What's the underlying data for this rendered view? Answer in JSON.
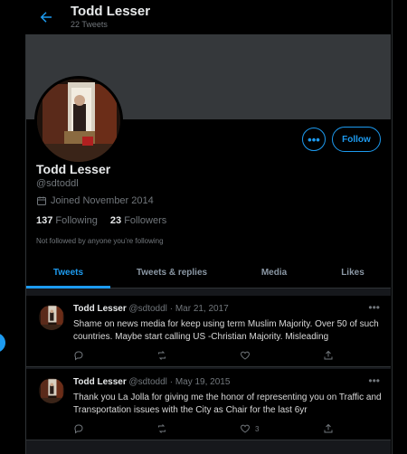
{
  "header": {
    "name": "Todd Lesser",
    "tweet_count": "22 Tweets"
  },
  "profile": {
    "name": "Todd Lesser",
    "handle": "@sdtoddl",
    "joined": "Joined November 2014",
    "following_count": "137",
    "following_label": "Following",
    "followers_count": "23",
    "followers_label": "Followers",
    "followed_note": "Not followed by anyone you’re following",
    "more_label": "•••",
    "follow_label": "Follow"
  },
  "tabs": [
    {
      "label": "Tweets"
    },
    {
      "label": "Tweets & replies"
    },
    {
      "label": "Media"
    },
    {
      "label": "Likes"
    }
  ],
  "tweets": [
    {
      "name": "Todd Lesser",
      "handle": "@sdtoddl",
      "dot": "·",
      "date": "Mar 21, 2017",
      "text": "Shame on news media for keep using term Muslim Majority. Over 50 of such countries. Maybe start calling US -Christian Majority. Misleading",
      "likes": "",
      "more": "•••"
    },
    {
      "name": "Todd Lesser",
      "handle": "@sdtoddl",
      "dot": "·",
      "date": "May 19, 2015",
      "text": "Thank you La Jolla for giving me the honor of representing you on Traffic and Transportation issues with the City as Chair for the last 6yr",
      "likes": "3",
      "more": "•••"
    }
  ],
  "colors": {
    "accent": "#1d9bf0",
    "background": "#000000",
    "muted": "#71767b"
  }
}
